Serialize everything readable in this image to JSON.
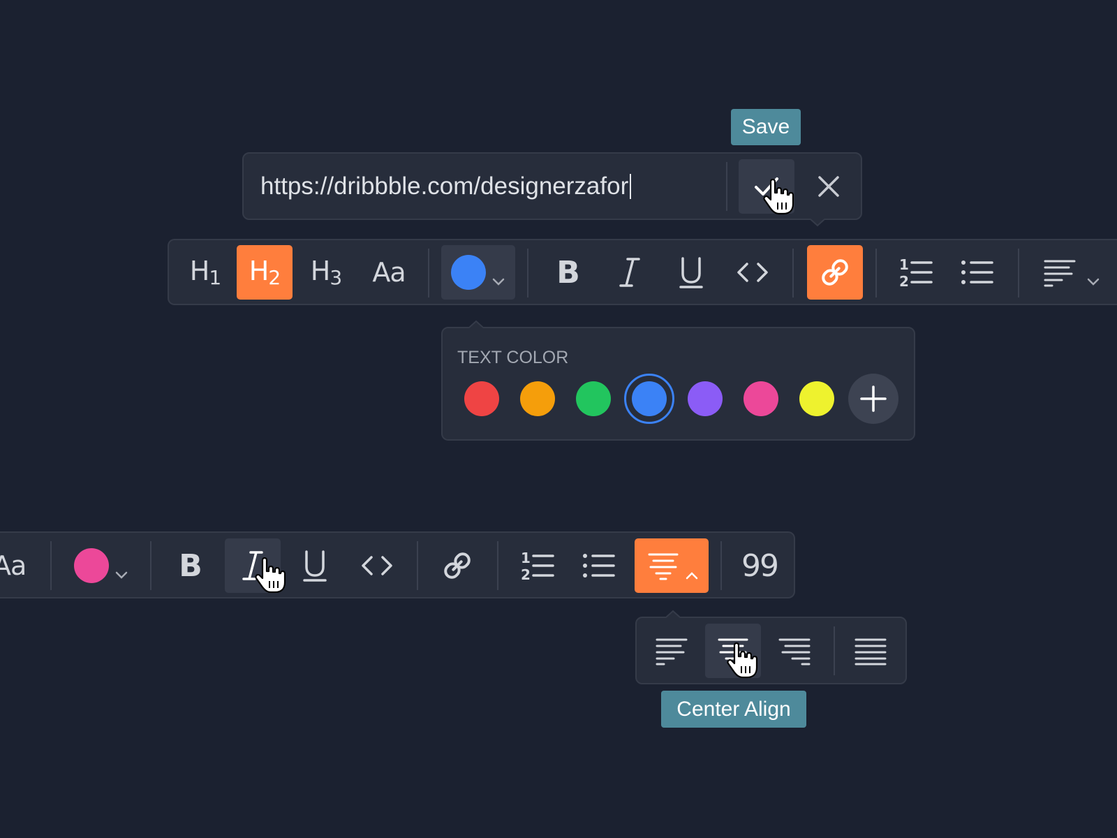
{
  "link_editor": {
    "url_value": "https://dribbble.com/designerzafor",
    "save_tooltip": "Save",
    "confirm_icon": "check-icon",
    "cancel_icon": "close-icon"
  },
  "toolbar_top": {
    "headings": [
      {
        "main": "H",
        "sub": "1"
      },
      {
        "main": "H",
        "sub": "2"
      },
      {
        "main": "H",
        "sub": "3"
      },
      {
        "main": "Aa",
        "sub": ""
      }
    ],
    "active_heading": "H2",
    "text_color": "#3b82f6",
    "formatting_icons": [
      "bold-icon",
      "italic-icon",
      "underline-icon",
      "code-icon"
    ],
    "bold_label": "B",
    "link_icon_active": true
  },
  "color_picker": {
    "title": "TEXT COLOR",
    "colors": [
      "#ef4444",
      "#f59e0b",
      "#22c55e",
      "#3b82f6",
      "#8b5cf6",
      "#ec4899",
      "#eef22e"
    ],
    "selected": "#3b82f6",
    "add_icon": "plus-icon"
  },
  "toolbar_bottom": {
    "heading_label": "Aa",
    "text_color": "#ec4899",
    "bold_label": "B",
    "quote_label": "99",
    "align_active": "center"
  },
  "align_menu": {
    "options": [
      "left",
      "center",
      "right",
      "justify"
    ],
    "hovered": "center",
    "tooltip": "Center Align"
  },
  "colors": {
    "background": "#1b2130",
    "panel": "#272d3b",
    "accent": "#ff7e3d",
    "tooltip": "#4e8a9b"
  }
}
